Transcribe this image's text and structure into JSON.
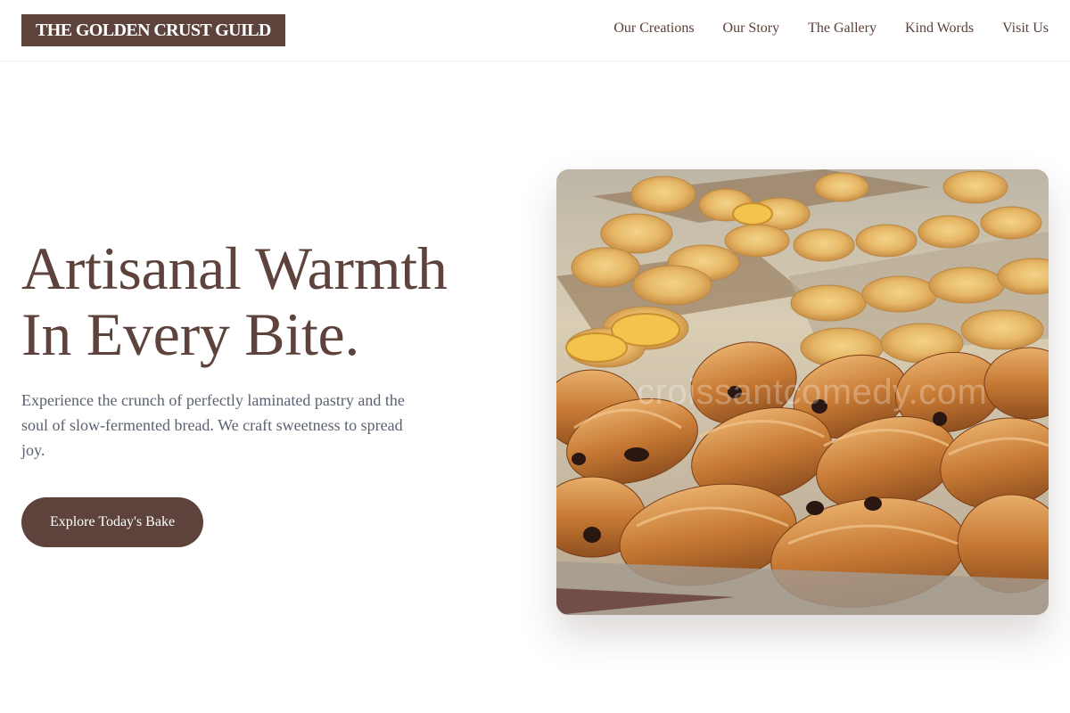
{
  "header": {
    "logo": "THE GOLDEN CRUST GUILD",
    "nav": [
      {
        "label": "Our Creations"
      },
      {
        "label": "Our Story"
      },
      {
        "label": "The Gallery"
      },
      {
        "label": "Kind Words"
      },
      {
        "label": "Visit Us"
      }
    ]
  },
  "hero": {
    "title_line1": "Artisanal Warmth",
    "title_line2": "In Every Bite.",
    "description": "Experience the crunch of perfectly laminated pastry and the soul of slow-fermented bread. We craft sweetness to spread joy.",
    "cta_label": "Explore Today's Bake",
    "image_watermark": "croissantcomedy.com"
  },
  "colors": {
    "brand": "#5d433c",
    "body_text": "#5a6170",
    "background": "#ffffff"
  }
}
